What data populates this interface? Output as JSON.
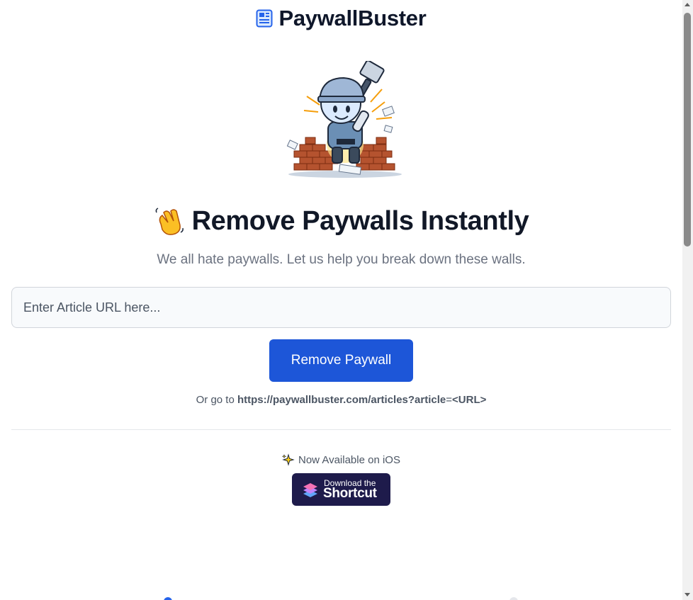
{
  "header": {
    "brand_name": "PaywallBuster",
    "brand_icon": "newspaper-icon"
  },
  "hero": {
    "image": "mascot-breaking-brick-wall-illustration"
  },
  "main": {
    "headline_icon": "waving-hand-icon",
    "headline": "Remove Paywalls Instantly",
    "subtitle": "We all hate paywalls. Let us help you break down these walls.",
    "url_input": {
      "placeholder": "Enter Article URL here...",
      "value": ""
    },
    "remove_button": "Remove Paywall",
    "hint_prefix": "Or go to",
    "hint_url": "https://paywallbuster.com/articles?article",
    "hint_equals": "=",
    "hint_param": "<URL>"
  },
  "ios": {
    "icon": "sparkles-icon",
    "text": "Now Available on iOS",
    "shortcut_small": "Download the",
    "shortcut_big": "Shortcut",
    "shortcut_icon": "shortcuts-app-icon"
  },
  "colors": {
    "accent": "#1d56d8",
    "shortcut_bg": "#1e1b4b",
    "text": "#111827",
    "muted": "#6b7280"
  }
}
